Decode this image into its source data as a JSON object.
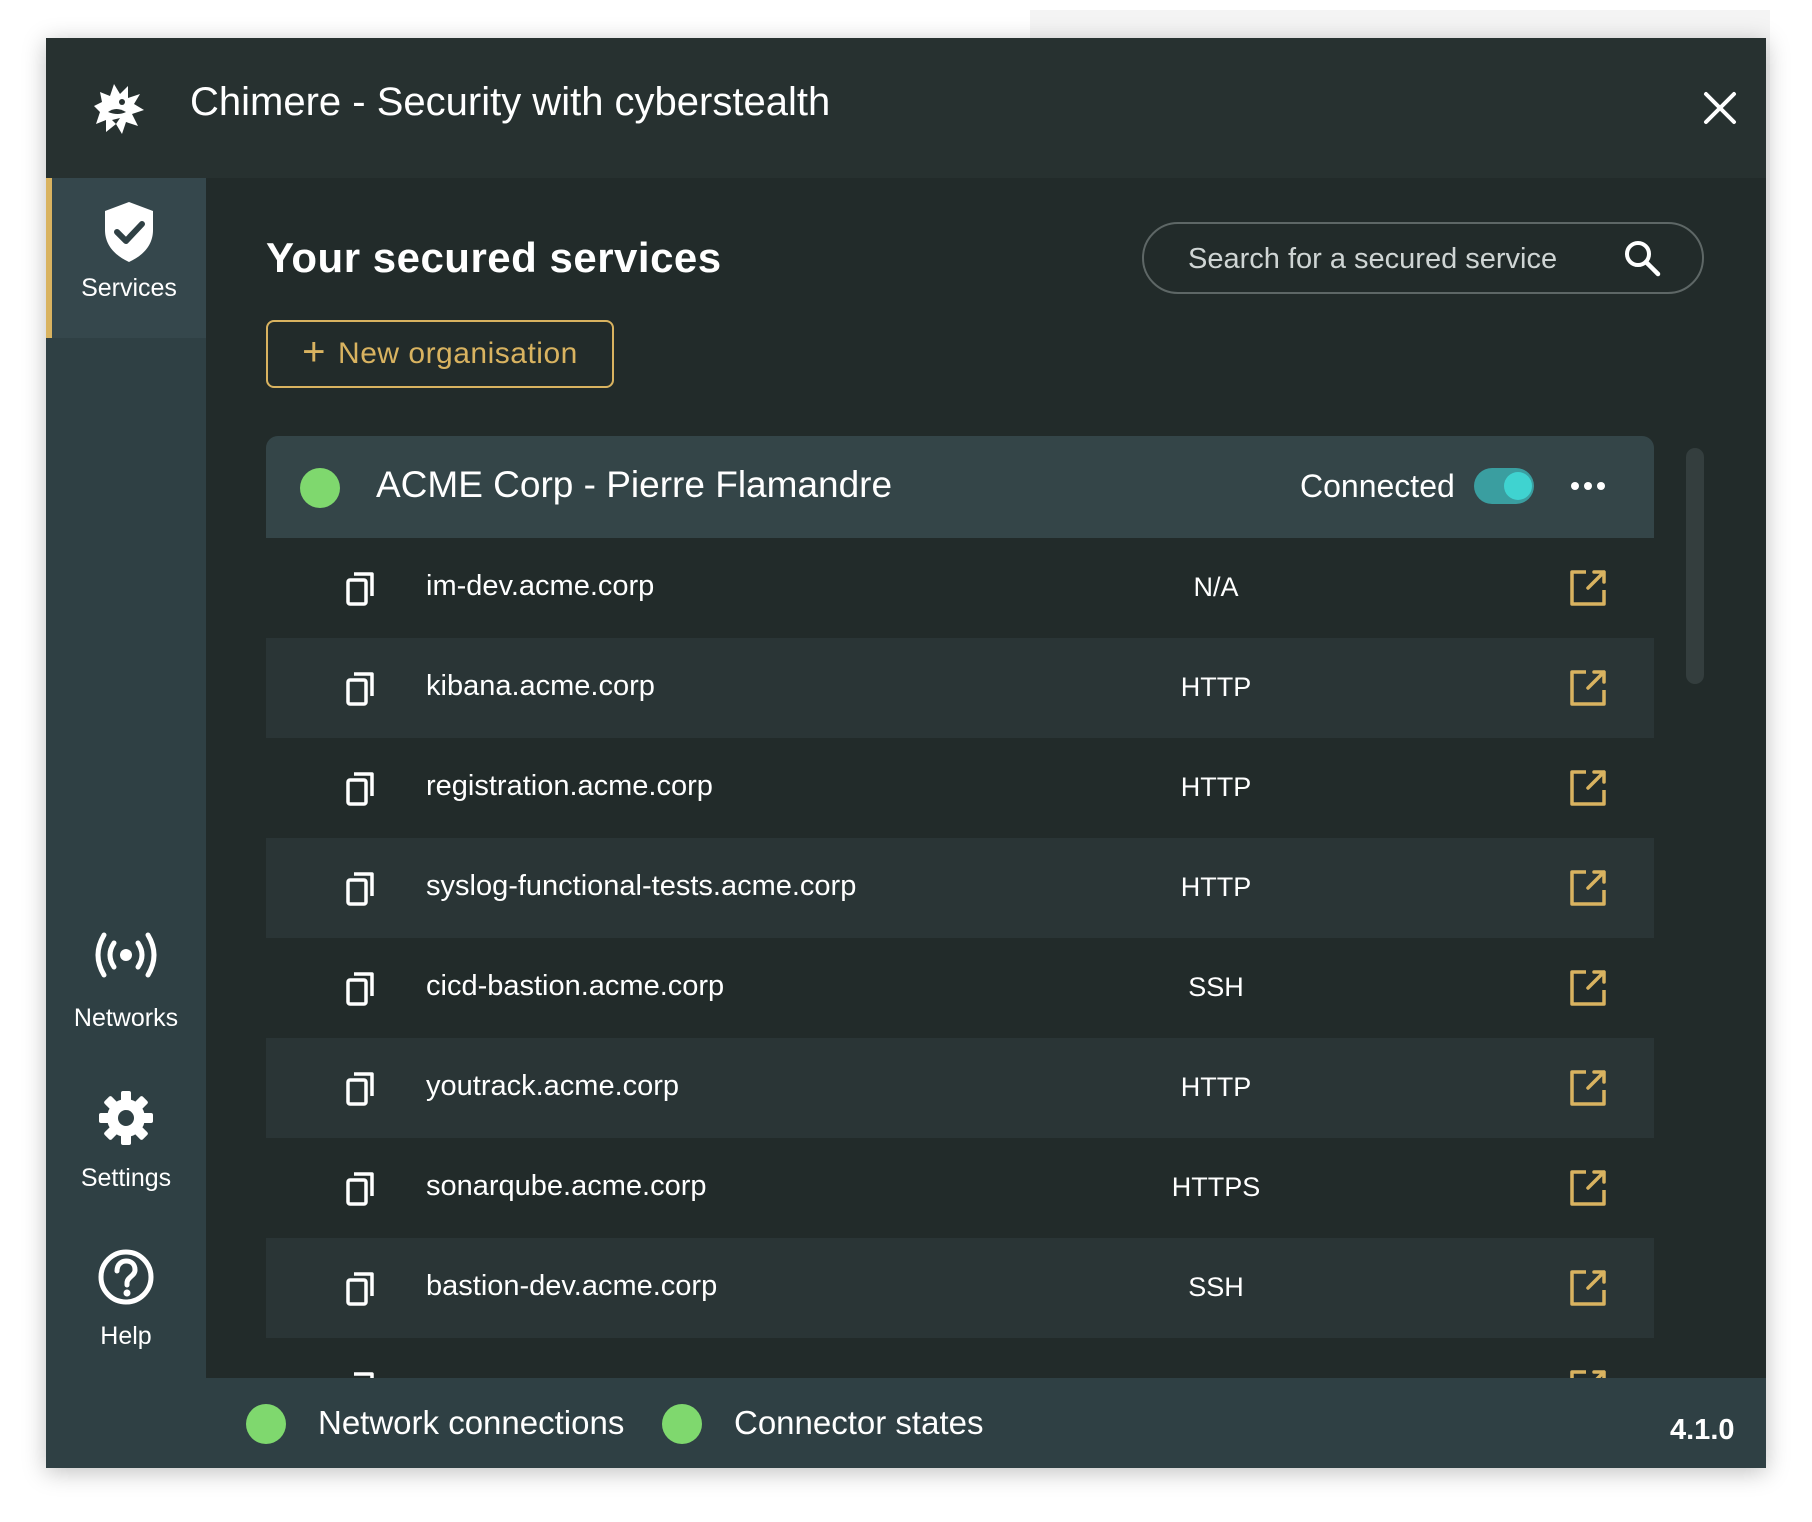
{
  "window": {
    "title": "Chimere - Security with cyberstealth"
  },
  "sidebar": {
    "items": [
      {
        "label": "Services",
        "icon": "shield-check-icon",
        "active": true
      },
      {
        "label": "Networks",
        "icon": "broadcast-icon",
        "active": false
      },
      {
        "label": "Settings",
        "icon": "gear-icon",
        "active": false
      },
      {
        "label": "Help",
        "icon": "help-circle-icon",
        "active": false
      }
    ]
  },
  "main": {
    "title": "Your secured services",
    "search_placeholder": "Search for a secured service",
    "new_org_label": "New organisation"
  },
  "organisation": {
    "name": "ACME Corp - Pierre Flamandre",
    "status": "Connected",
    "toggle_on": true,
    "services": [
      {
        "host": "im-dev.acme.corp",
        "protocol": "N/A"
      },
      {
        "host": "kibana.acme.corp",
        "protocol": "HTTP"
      },
      {
        "host": "registration.acme.corp",
        "protocol": "HTTP"
      },
      {
        "host": "syslog-functional-tests.acme.corp",
        "protocol": "HTTP"
      },
      {
        "host": "cicd-bastion.acme.corp",
        "protocol": "SSH"
      },
      {
        "host": "youtrack.acme.corp",
        "protocol": "HTTP"
      },
      {
        "host": "sonarqube.acme.corp",
        "protocol": "HTTPS"
      },
      {
        "host": "bastion-dev.acme.corp",
        "protocol": "SSH"
      }
    ]
  },
  "footer": {
    "network_label": "Network connections",
    "connector_label": "Connector states",
    "version": "4.1.0"
  },
  "colors": {
    "accent": "#d9b360",
    "status_ok": "#7fd86e",
    "toggle": "#3fd3d0",
    "background": "#222b2a",
    "sidebar": "#2f4044"
  }
}
